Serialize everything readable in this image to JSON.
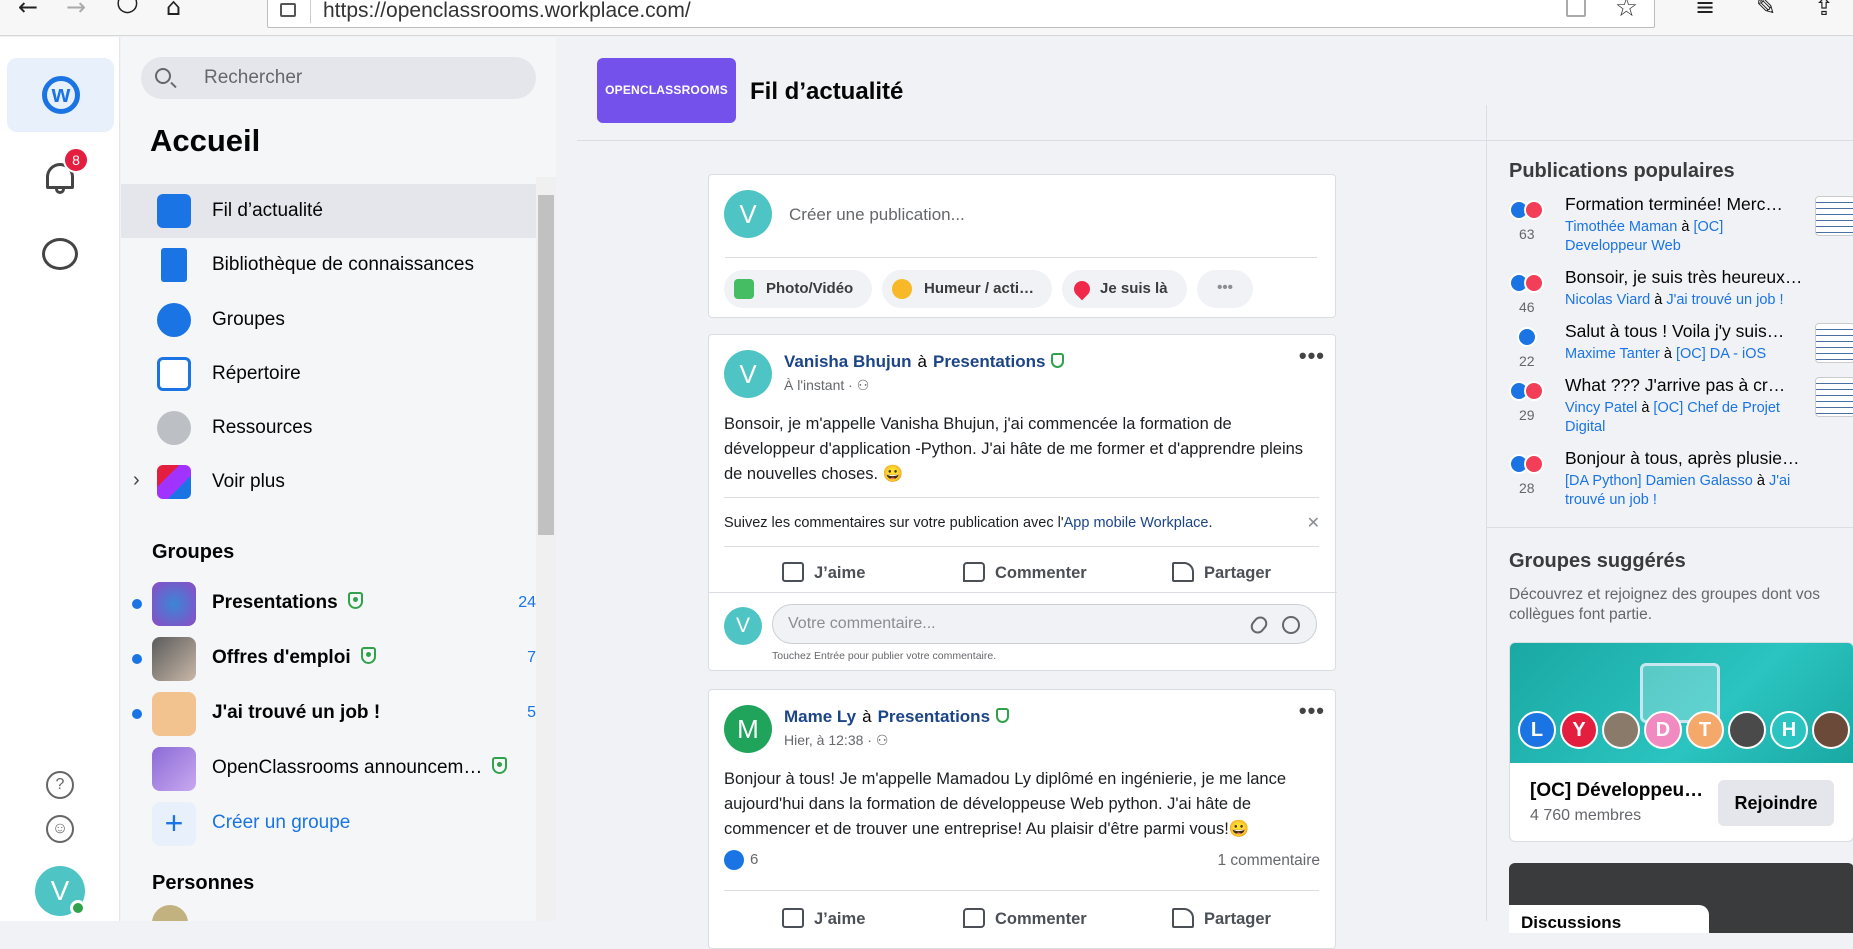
{
  "browser": {
    "url": "https://openclassrooms.workplace.com/"
  },
  "rail": {
    "notification_count": "8",
    "user_initial": "V"
  },
  "nav": {
    "search_placeholder": "Rechercher",
    "title": "Accueil",
    "items": [
      {
        "label": "Fil d’actualité",
        "icon": "news-feed-icon"
      },
      {
        "label": "Bibliothèque de connaissances",
        "icon": "book-icon"
      },
      {
        "label": "Groupes",
        "icon": "groups-icon"
      },
      {
        "label": "Répertoire",
        "icon": "directory-icon"
      },
      {
        "label": "Ressources",
        "icon": "link-icon"
      },
      {
        "label": "Voir plus",
        "icon": "apps-icon"
      }
    ],
    "groups_heading": "Groupes",
    "groups": [
      {
        "name": "Presentations",
        "count": "24"
      },
      {
        "name": "Offres d'emploi",
        "count": "7"
      },
      {
        "name": "J'ai trouvé un job !",
        "count": "5"
      },
      {
        "name": "OpenClassrooms announcem…",
        "count": ""
      }
    ],
    "create_group": "Créer un groupe",
    "people_heading": "Personnes"
  },
  "main": {
    "logo_text": "OPENCLASSROOMS",
    "title": "Fil d’actualité",
    "composer": {
      "avatar": "V",
      "placeholder": "Créer une publication...",
      "chips": [
        "Photo/Vidéo",
        "Humeur / acti…",
        "Je suis là"
      ]
    },
    "post1": {
      "avatar": "V",
      "author": "Vanisha Bhujun",
      "a": "à",
      "group": "Presentations",
      "time": "À l'instant ·",
      "text": "Bonsoir, je m'appelle Vanisha Bhujun, j'ai commencée la formation de développeur d'application -Python. J'ai hâte de me former et d'apprendre pleins de nouvelles choses. 😀",
      "notice_text": "Suivez les commentaires sur votre publication avec l'",
      "notice_link": "App mobile Workplace",
      "like": "J’aime",
      "comment": "Commenter",
      "share": "Partager",
      "comment_avatar": "V",
      "comment_placeholder": "Votre commentaire...",
      "hint": "Touchez Entrée pour publier votre commentaire."
    },
    "post2": {
      "avatar": "M",
      "author": "Mame Ly",
      "a": "à",
      "group": "Presentations",
      "time": "Hier, à 12:38 ·",
      "text": "Bonjour à tous! Je m'appelle Mamadou Ly diplômé en ingénierie, je me lance aujourd'hui dans la formation de développeuse Web python. J'ai hâte de commencer et de trouver une entreprise! Au plaisir d'être parmi vous!😀",
      "likes": "6",
      "comments": "1 commentaire",
      "like": "J’aime",
      "comment": "Commenter",
      "share": "Partager"
    }
  },
  "right": {
    "popular_heading": "Publications populaires",
    "popular": [
      {
        "title": "Formation terminée! Merc…",
        "count": "63",
        "author": "Timothée Maman",
        "a": "à",
        "group": "[OC] Developpeur Web",
        "hearts": true
      },
      {
        "title": "Bonsoir, je suis très heureux de …",
        "count": "46",
        "author": "Nicolas Viard",
        "a": "à",
        "group": "J'ai trouvé un job !",
        "hearts": true
      },
      {
        "title": "Salut à tous ! Voila j'y suis…",
        "count": "22",
        "author": "Maxime Tanter",
        "a": "à",
        "group": "[OC] DA - iOS",
        "hearts": false
      },
      {
        "title": "What ??? J'arrive pas à cr…",
        "count": "29",
        "author": "Vincy Patel",
        "a": "à",
        "group": "[OC] Chef de Projet Digital",
        "hearts": true
      },
      {
        "title": "Bonjour à tous, après plusieurs …",
        "count": "28",
        "author": "[DA Python] Damien Galasso",
        "a": "à",
        "group": "J'ai trouvé un job !",
        "hearts": true
      }
    ],
    "suggested_heading": "Groupes suggérés",
    "suggested_desc": "Découvrez et rejoignez des groupes dont vos collègues font partie.",
    "suggested_group": {
      "name": "[OC] Développeu…",
      "members": "4 760 membres",
      "join": "Rejoindre",
      "member_initials": [
        "L",
        "Y",
        "",
        "D",
        "T",
        "",
        "H",
        ""
      ]
    },
    "next_card_title": "Discussions"
  },
  "colors": {
    "accent": "#1b74e4",
    "logo": "#7451eb",
    "avatar_teal": "#4fc4c4",
    "avatar_green": "#20a35a",
    "notification": "#e41e3f"
  }
}
